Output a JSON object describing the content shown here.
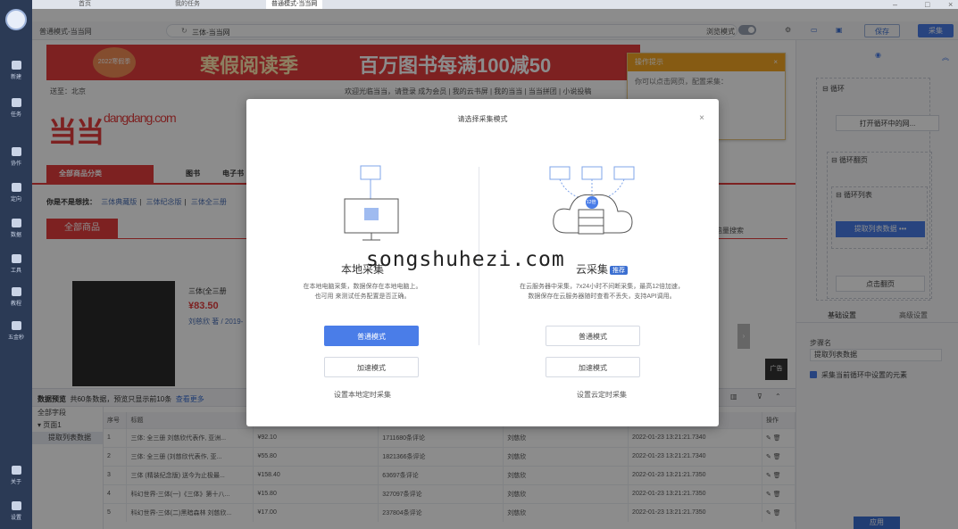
{
  "rail": {
    "items": [
      "新建",
      "任务",
      "协作",
      "定向",
      "数据",
      "工具",
      "教程",
      "五金秒",
      "关于",
      "设置"
    ]
  },
  "tabs": {
    "home": "首页",
    "tasks": "我的任务",
    "active": "普通模式-当当网"
  },
  "toolbar": {
    "mode_label": "普通模式-当当网",
    "url": "三体-当当网",
    "browse_label": "浏览模式",
    "save_label": "保存",
    "collect_label": "采集"
  },
  "page": {
    "banner_badge": "2022寒假季",
    "banner_title": "寒假阅读季",
    "banner_promo": "百万图书每满100减50",
    "ship_to": "送至：北京",
    "top_links": "欢迎光临当当，请登录 成为会员 | 我的云书屏 | 我的当当 | 当当拼团 | 小说投稿",
    "logo": "当当",
    "logo_en": "dangdang.com",
    "all_categories": "全部商品分类",
    "cat_books": "图书",
    "cat_electronic": "电子书",
    "also_label": "你是不是想找：",
    "also_items": [
      "三体典藏版",
      "三体纪念版",
      "三体全三册"
    ],
    "all_products_tab": "全部商品",
    "ask_label": "脑量搜索",
    "product_title": "三体(全三册",
    "product_price": "¥83.50",
    "author": "刘慈欣 著 / 2019-",
    "ad_label": "广告"
  },
  "tips": {
    "title": "操作提示",
    "body": "你可以点击网页，配置采集："
  },
  "preview": {
    "header": "数据预览",
    "count_text": "共60条数据，预览只显示前10条",
    "view_more": "查看更多",
    "tree_all": "全部字段",
    "tree_page": "页面1",
    "tree_extract": "提取列表数据",
    "columns": [
      "序号",
      "标题",
      "",
      "",
      "",
      "",
      "操作"
    ],
    "rows": [
      [
        "1",
        "三体: 全三册 刘慈欣代表作, 亚洲...",
        "¥92.10",
        "1711680条评论",
        "刘慈欣",
        "2022-01-23 13:21:21.7340"
      ],
      [
        "2",
        "三体: 全三册 (刘慈欣代表作, 亚...",
        "¥55.80",
        "1821366条评论",
        "刘慈欣",
        "2022-01-23 13:21:21.7340"
      ],
      [
        "3",
        "三体 (精装纪念版) 送今为止极最...",
        "¥158.40",
        "63697条评论",
        "刘慈欣",
        "2022-01-23 13:21:21.7350"
      ],
      [
        "4",
        "科幻世界-三体(一)《三体》第十八...",
        "¥15.80",
        "327097条评论",
        "刘慈欣",
        "2022-01-23 13:21:21.7350"
      ],
      [
        "5",
        "科幻世界-三体(二)黑暗森林 刘慈欣...",
        "¥17.00",
        "237804条评论",
        "刘慈欣",
        "2022-01-23 13:21:21.7350"
      ]
    ]
  },
  "workflow": {
    "loop": "循环",
    "open_page": "打开循环中的网...",
    "loop_page": "循环翻页",
    "loop_list": "循环列表",
    "extract": "提取列表数据",
    "click_next": "点击翻页",
    "tab_basic": "基础设置",
    "tab_advanced": "高级设置",
    "step_name_label": "步骤名",
    "step_name_value": "提取列表数据",
    "checkbox_label": "采集当前循环中设置的元素",
    "apply": "应用"
  },
  "modal": {
    "title": "请选择采集模式",
    "local_name": "本地采集",
    "local_desc_1": "在本地电脑采集，数据保存在本地电脑上。",
    "local_desc_2": "也可用 来测试任务配置是否正确。",
    "cloud_name": "云采集",
    "cloud_badge": "推荐",
    "cloud_desc_1": "在云服务器中采集，7x24小时不间断采集，最高12倍加速，",
    "cloud_desc_2": "数据保存在云服务器随时查看不丢失，支持API调用。",
    "normal_mode": "普通模式",
    "speed_mode": "加速模式",
    "local_timed": "设置本地定时采集",
    "cloud_timed": "设置云定时采集",
    "cloud_speed": "12倍",
    "watermark": "songshuhezi.com"
  },
  "colors": {
    "accent": "#4a7de8",
    "brand_red": "#e33d3d",
    "rail": "#2b3a55"
  }
}
